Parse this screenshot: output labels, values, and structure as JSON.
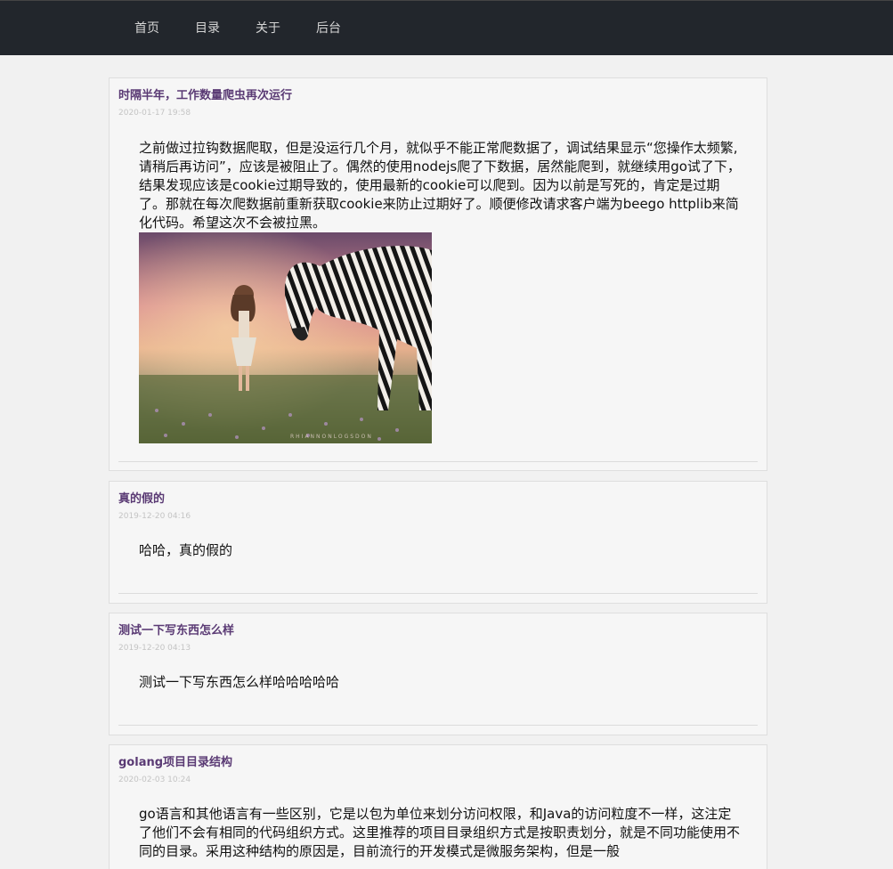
{
  "nav": {
    "items": [
      {
        "label": "首页"
      },
      {
        "label": "目录"
      },
      {
        "label": "关于"
      },
      {
        "label": "后台"
      }
    ]
  },
  "posts": [
    {
      "title": "时隔半年，工作数量爬虫再次运行",
      "date": "2020-01-17 19:58",
      "body": "之前做过拉钩数据爬取，但是没运行几个月，就似乎不能正常爬数据了，调试结果显示“您操作太频繁,请稍后再访问”，应该是被阻止了。偶然的使用nodejs爬了下数据，居然能爬到，就继续用go试了下，结果发现应该是cookie过期导致的，使用最新的cookie可以爬到。因为以前是写死的，肯定是过期了。那就在每次爬数据前重新获取cookie来防止过期好了。顺便修改请求客户端为beego httplib来简化代码。希望这次不会被拉黑。",
      "image_watermark": "RHIANNONLOGSDON"
    },
    {
      "title": "真的假的",
      "date": "2019-12-20 04:16",
      "body": "哈哈，真的假的"
    },
    {
      "title": "测试一下写东西怎么样",
      "date": "2019-12-20 04:13",
      "body": "测试一下写东西怎么样哈哈哈哈哈"
    },
    {
      "title": "golang项目目录结构",
      "date": "2020-02-03 10:24",
      "body": "go语言和其他语言有一些区别，它是以包为单位来划分访问权限，和Java的访问粒度不一样，这注定了他们不会有相同的代码组织方式。这里推荐的项目目录组织方式是按职责划分，就是不同功能使用不同的目录。采用这种结构的原因是，目前流行的开发模式是微服务架构，但是一般"
    }
  ]
}
